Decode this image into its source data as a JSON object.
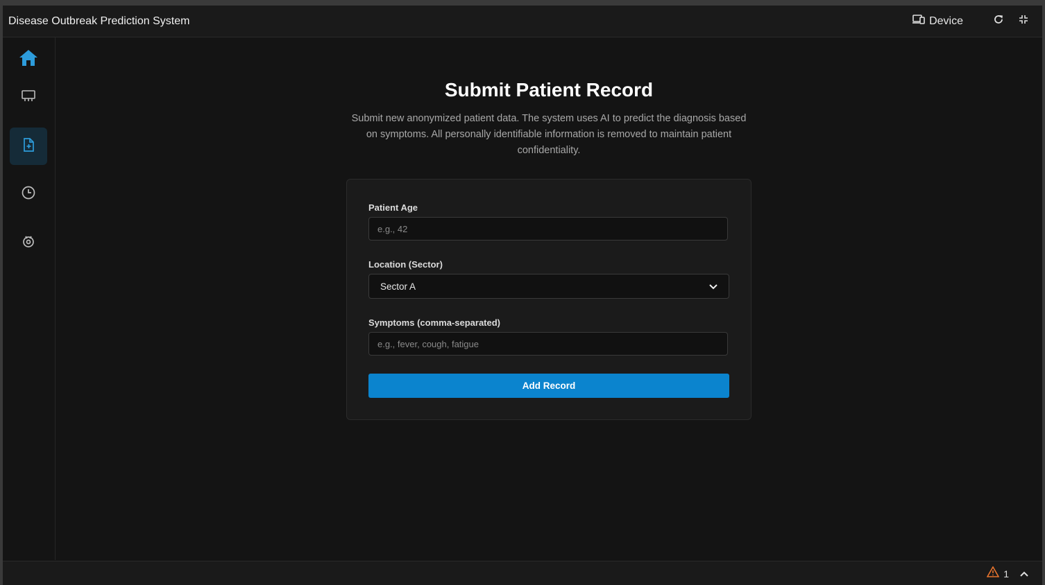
{
  "window": {
    "title": "Disease Outbreak Prediction System",
    "device_label": "Device",
    "icons": [
      "device-icon",
      "refresh-icon",
      "fullscreen-icon"
    ]
  },
  "sidebar": {
    "items": [
      {
        "name": "home",
        "icon": "home-icon",
        "active": false,
        "color": "#2d9cdb"
      },
      {
        "name": "monitor",
        "icon": "monitor-icon",
        "active": false
      },
      {
        "name": "submit-record",
        "icon": "file-plus-icon",
        "active": true
      },
      {
        "name": "history",
        "icon": "clock-icon",
        "active": false
      },
      {
        "name": "analytics",
        "icon": "biohazard-icon",
        "active": false
      }
    ]
  },
  "page": {
    "title": "Submit Patient Record",
    "description": "Submit new anonymized patient data. The system uses AI to predict the diagnosis based on symptoms. All personally identifiable information is removed to maintain patient confidentiality."
  },
  "form": {
    "age": {
      "label": "Patient Age",
      "placeholder": "e.g., 42",
      "value": ""
    },
    "location": {
      "label": "Location (Sector)",
      "selected": "Sector A"
    },
    "symptoms": {
      "label": "Symptoms (comma-separated)",
      "placeholder": "e.g., fever, cough, fatigue",
      "value": ""
    },
    "submit_label": "Add Record"
  },
  "statusbar": {
    "warning_count": "1"
  },
  "colors": {
    "accent": "#0b84ce",
    "active_icon": "#2d9cdb",
    "warning": "#e8742d",
    "background": "#141414"
  }
}
